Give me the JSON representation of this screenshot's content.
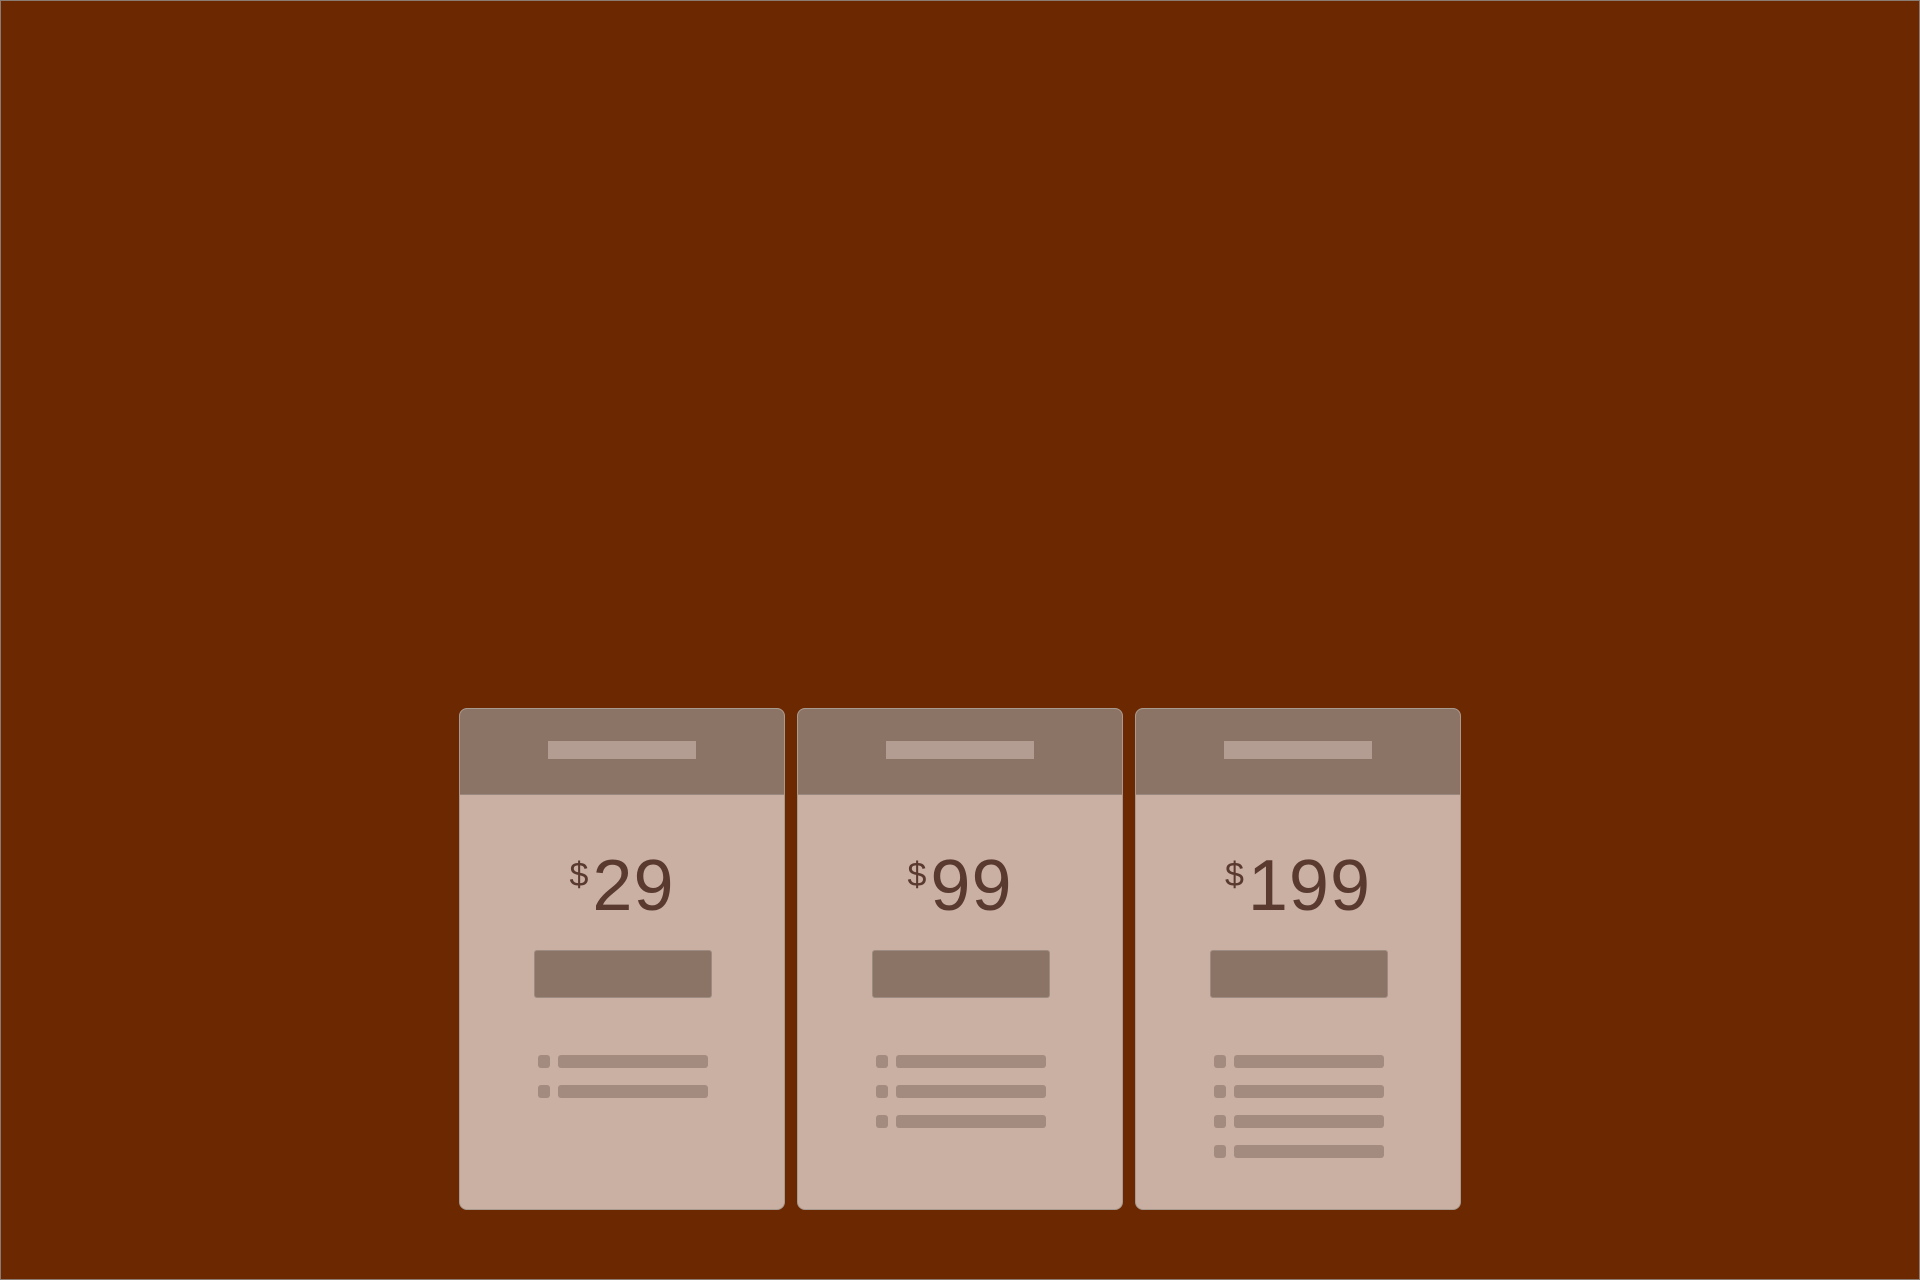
{
  "colors": {
    "background": "#6b2801",
    "card": "#cab0a3",
    "header": "#8b7366",
    "accent_placeholder": "#a48b7f",
    "price_text": "#5a3a2e"
  },
  "plans": [
    {
      "currency": "$",
      "amount": "29",
      "feature_count": 2
    },
    {
      "currency": "$",
      "amount": "99",
      "feature_count": 3
    },
    {
      "currency": "$",
      "amount": "199",
      "feature_count": 4
    }
  ]
}
